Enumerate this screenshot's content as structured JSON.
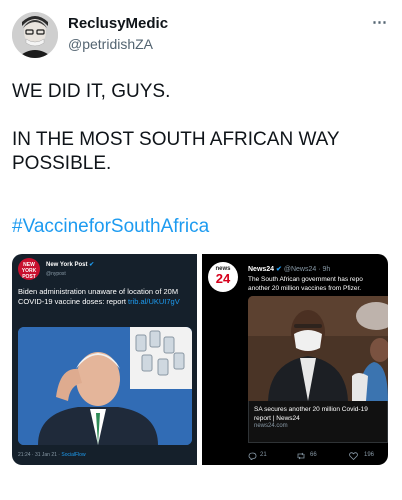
{
  "author": {
    "display_name": "ReclusyMedic",
    "handle": "@petridishZA",
    "more_icon": "⋯"
  },
  "tweet": {
    "line1": "WE DID IT, GUYS.",
    "line2": "IN THE MOST SOUTH AFRICAN WAY",
    "line3": "POSSIBLE.",
    "hashtag": "#VaccineforSouthAfrica"
  },
  "embedded_left": {
    "logo_text": "NEW YORK POST",
    "name": "New York Post",
    "verified": "✔",
    "handle": "@nypost",
    "text": "Biden administration unaware of location of 20M COVID-19 vaccine doses: report ",
    "link": "trib.al/UKUI7gV",
    "meta": "21:24 · 31 Jan 21 · ",
    "source": "SocialFlow"
  },
  "embedded_right": {
    "logo_top": "news",
    "logo_num": "24",
    "name": "News24",
    "verified": "✔",
    "handle_time": "@News24 · 9h",
    "text1": "The South African government has repo",
    "text2": "another 20 million vaccines from Pfizer.",
    "caption1": "SA secures another 20 million Covid-19",
    "caption2": "report | News24",
    "caption_domain": "news24.com",
    "replies": "21",
    "retweets": "66",
    "likes": "196"
  },
  "colors": {
    "link": "#1d9bf0",
    "secondary": "#536471"
  }
}
